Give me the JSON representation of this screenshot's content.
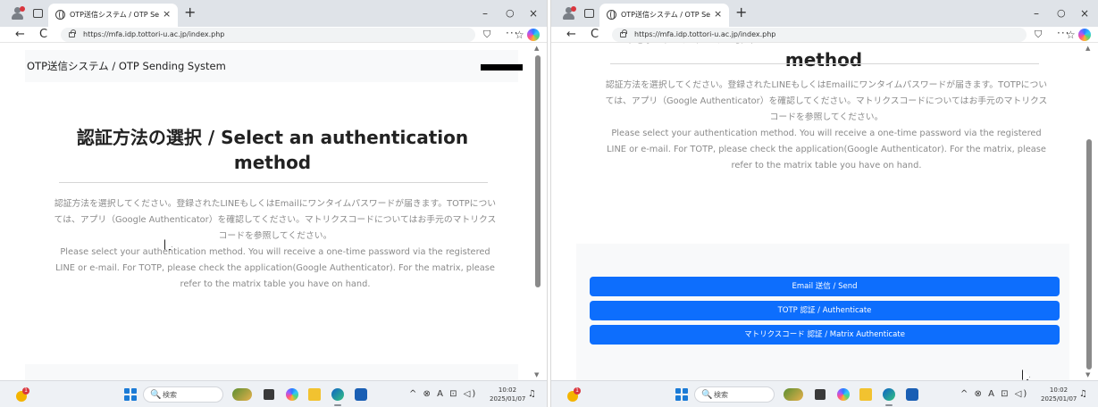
{
  "browser": {
    "tab_title": "OTP送信システム / OTP Sending Sy",
    "tab_close": "×",
    "new_tab": "+",
    "url": "https://mfa.idp.tottori-u.ac.jp/index.php",
    "minimize": "–",
    "maximize": "○",
    "close": "×",
    "back": "←",
    "reload": "C",
    "favorites": "☆",
    "collections": "⛉",
    "more": "···"
  },
  "page": {
    "brand": "OTP送信システム / OTP Sending System",
    "heading": "認証方法の選択 / Select an authentication method",
    "instruction_ja": "認証方法を選択してください。登録されたLINEもしくはEmailにワンタイムパスワードが届きます。TOTPについては、アプリ（Google Authenticator）を確認してください。マトリクスコードについてはお手元のマトリクスコードを参照してください。",
    "instruction_en": "Please select your authentication method. You will receive a one-time password via the registered LINE or e-mail. For TOTP, please check the application(Google Authenticator). For the matrix, please refer to the matrix table you have on hand.",
    "buttons": {
      "email": "Email 送信 / Send",
      "totp": "TOTP 認証 / Authenticate",
      "matrix": "マトリクスコード 認証 / Matrix Authenticate"
    }
  },
  "taskbar": {
    "search_placeholder": "検索",
    "search_glyph": "🔍",
    "weather_badge": "1",
    "tray": "^ ⊗ A ⊡ ◁)",
    "time": "10:02",
    "date": "2025/01/07",
    "notification": "♫"
  },
  "icons": {
    "profile": "profile-icon",
    "tabs": "tab-actions-icon",
    "globe": "globe-icon",
    "lock": "lock-icon",
    "copilot": "copilot-icon",
    "start": "windows-start-icon"
  },
  "colors": {
    "primary_button": "#0d6efd",
    "header_bg": "#f8f9fa",
    "muted_text": "#8a8a8a",
    "titlebar_bg": "#dfe3e8"
  }
}
